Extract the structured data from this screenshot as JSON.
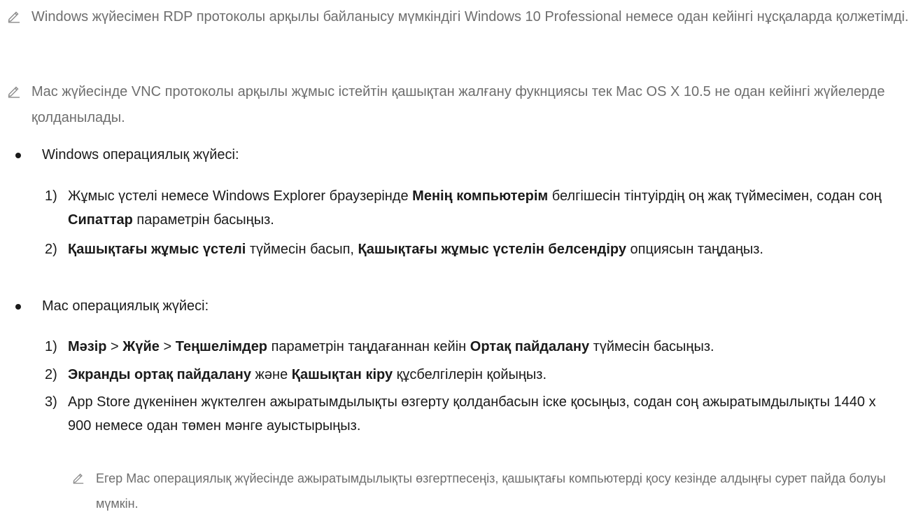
{
  "notes": [
    "Windows жүйесімен RDP протоколы арқылы байланысу мүмкіндігі Windows 10 Professional немесе одан кейінгі нұсқаларда қолжетімді.",
    "Mac жүйесінде VNC протоколы арқылы жұмыс істейтін қашықтан жалғану фукнциясы тек Mac OS X 10.5 не одан кейінгі жүйелерде қолданылады."
  ],
  "windows": {
    "title": "Windows операциялық жүйесі:",
    "step1": {
      "num": "1)",
      "t1": "Жұмыс үстелі немесе Windows Explorer браузерінде ",
      "b1": "Менің компьютерім",
      "t2": " белгішесін тінтуірдің оң жақ түймесімен, содан соң ",
      "b2": "Сипаттар",
      "t3": " параметрін басыңыз."
    },
    "step2": {
      "num": "2)",
      "b1": "Қашықтағы жұмыс үстелі",
      "t1": " түймесін басып, ",
      "b2": "Қашықтағы жұмыс үстелін белсендіру",
      "t2": " опциясын таңдаңыз."
    }
  },
  "mac": {
    "title": "Mac операциялық жүйесі:",
    "step1": {
      "num": "1)",
      "b1": "Мәзір",
      "sep1": " > ",
      "b2": "Жүйе",
      "sep2": " > ",
      "b3": "Теңшелімдер",
      "t1": " параметрін таңдағаннан кейін ",
      "b4": "Ортақ пайдалану",
      "t2": " түймесін басыңыз."
    },
    "step2": {
      "num": "2)",
      "b1": "Экранды ортақ пайдалану",
      "t1": " және ",
      "b2": "Қашықтан кіру",
      "t2": " құсбелгілерін қойыңыз."
    },
    "step3": {
      "num": "3)",
      "text": "App Store дүкенінен жүктелген ажыратымдылықты өзгерту қолданбасын іске қосыңыз, содан соң ажыратымдылықты 1440 x 900 немесе одан төмен мәнге ауыстырыңыз."
    },
    "subnote": "Егер Mac операциялық жүйесінде ажыратымдылықты өзгертпесеңіз, қашықтағы компьютерді қосу кезінде алдыңғы сурет пайда болуы мүмкін."
  }
}
